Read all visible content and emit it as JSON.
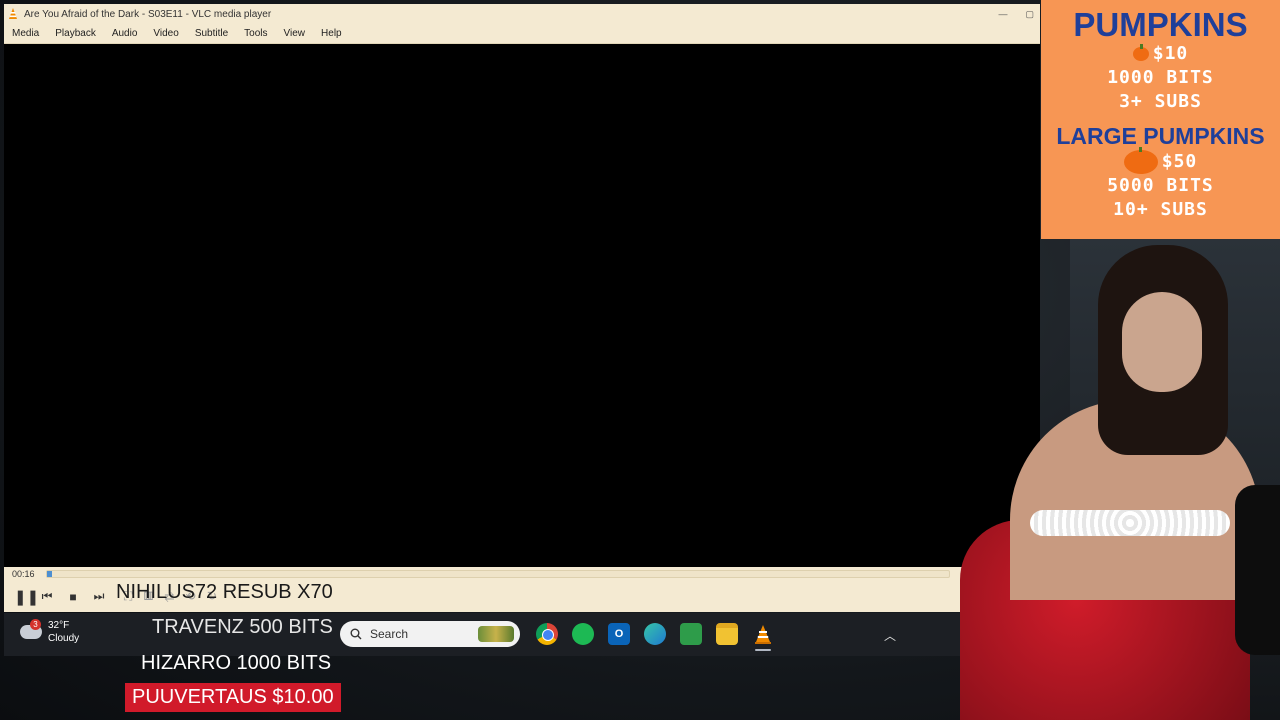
{
  "vlc": {
    "title": "Are You Afraid of the Dark - S03E11 - VLC media player",
    "menu": [
      "Media",
      "Playback",
      "Audio",
      "Video",
      "Subtitle",
      "Tools",
      "View",
      "Help"
    ],
    "elapsed": "00:16",
    "progress_percent": 0.6
  },
  "taskbar": {
    "weather_temp": "32°F",
    "weather_cond": "Cloudy",
    "weather_badge": "3",
    "search_label": "Search",
    "apps": [
      "chrome-icon",
      "spotify-icon",
      "outlook-icon",
      "edge-icon",
      "notepad-icon",
      "file-explorer-icon",
      "vlc-icon"
    ]
  },
  "alerts": {
    "nihilus": "NIHILUS72  RESUB X70",
    "travenz": "TRAVENZ  500 BITS",
    "hizarro": "HIZARRO  1000 BITS",
    "puuvertaus": "PUUVERTAUS  $10.00"
  },
  "pumpkins": {
    "title": "PUMPKINS",
    "price": "$10",
    "bits": "1000 BITS",
    "subs": "3+ SUBS",
    "large_title": "LARGE PUMPKINS",
    "large_price": "$50",
    "large_bits": "5000 BITS",
    "large_subs": "10+ SUBS"
  },
  "colors": {
    "panel_bg": "#f79654",
    "panel_title": "#1f3f9a",
    "vlc_chrome": "#f4ead2",
    "seek_fill": "#4d8fd1",
    "donation_bg": "#d11a2a"
  }
}
